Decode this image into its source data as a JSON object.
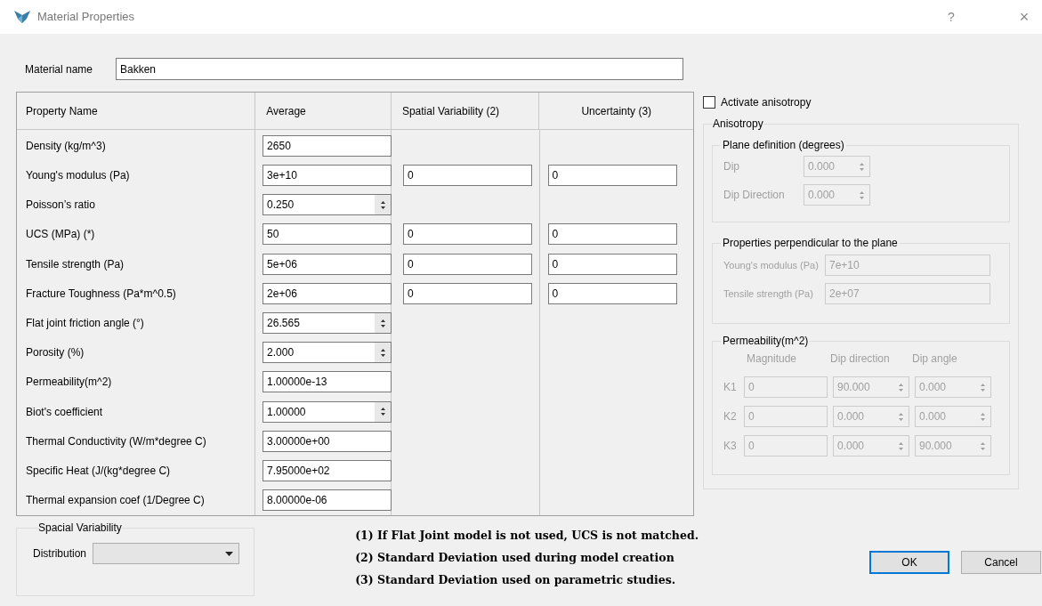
{
  "window": {
    "title": "Material Properties",
    "help": "?",
    "close": "×"
  },
  "material_name": {
    "label": "Material name",
    "value": "Bakken"
  },
  "table": {
    "columns": [
      "Property Name",
      "Average",
      "Spatial Variability (2)",
      "Uncertainty (3)"
    ],
    "rows": [
      {
        "name": "Density (kg/m^3)",
        "kind": "text",
        "average": "2650"
      },
      {
        "name": "Young's modulus (Pa)",
        "kind": "text",
        "average": "3e+10",
        "spatial": "0",
        "uncertainty": "0"
      },
      {
        "name": "Poisson’s ratio",
        "kind": "spin",
        "average": "0.250"
      },
      {
        "name": "UCS (MPa) (*)",
        "kind": "text",
        "average": "50",
        "spatial": "0",
        "uncertainty": "0"
      },
      {
        "name": "Tensile strength (Pa)",
        "kind": "text",
        "average": "5e+06",
        "spatial": "0",
        "uncertainty": "0"
      },
      {
        "name": "Fracture Toughness (Pa*m^0.5)",
        "kind": "text",
        "average": "2e+06",
        "spatial": "0",
        "uncertainty": "0"
      },
      {
        "name": "Flat joint friction angle (°)",
        "kind": "spin",
        "average": "26.565"
      },
      {
        "name": "Porosity (%)",
        "kind": "spin",
        "average": "2.000"
      },
      {
        "name": "Permeability(m^2)",
        "kind": "text",
        "average": "1.00000e-13"
      },
      {
        "name": "Biot's coefficient",
        "kind": "spin",
        "average": "1.00000"
      },
      {
        "name": "Thermal Conductivity (W/m*degree C)",
        "kind": "text",
        "average": "3.00000e+00"
      },
      {
        "name": "Specific Heat (J/(kg*degree C)",
        "kind": "text",
        "average": "7.95000e+02"
      },
      {
        "name": "Thermal expansion coef (1/Degree C)",
        "kind": "text",
        "average": "8.00000e-06"
      }
    ]
  },
  "spacial_variability": {
    "title": "Spacial Variability",
    "label": "Distribution"
  },
  "notes": [
    "(1) If Flat Joint model is not used, UCS is not matched.",
    "(2) Standard Deviation used during model creation",
    "(3) Standard Deviation used on parametric studies."
  ],
  "anisotropy": {
    "checkbox": {
      "label": "Activate anisotropy",
      "checked": false
    },
    "title": "Anisotropy",
    "disabled": true,
    "plane": {
      "title": "Plane definition (degrees)",
      "rows": [
        {
          "label": "Dip",
          "value": "0.000"
        },
        {
          "label": "Dip Direction",
          "value": "0.000"
        }
      ]
    },
    "perpendicular": {
      "title": "Properties perpendicular to the plane",
      "rows": [
        {
          "label": "Young's modulus (Pa)",
          "value": "7e+10"
        },
        {
          "label": "Tensile strength (Pa)",
          "value": "2e+07"
        }
      ]
    },
    "permeability": {
      "title": "Permeability(m^2)",
      "columns": [
        "Magnitude",
        "Dip direction",
        "Dip angle"
      ],
      "rows": [
        {
          "label": "K1",
          "magnitude": "0",
          "dip_direction": "90.000",
          "dip_angle": "0.000"
        },
        {
          "label": "K2",
          "magnitude": "0",
          "dip_direction": "0.000",
          "dip_angle": "0.000"
        },
        {
          "label": "K3",
          "magnitude": "0",
          "dip_direction": "0.000",
          "dip_angle": "90.000"
        }
      ]
    }
  },
  "buttons": [
    {
      "label": "OK",
      "default": true
    },
    {
      "label": "Cancel",
      "default": false
    }
  ]
}
